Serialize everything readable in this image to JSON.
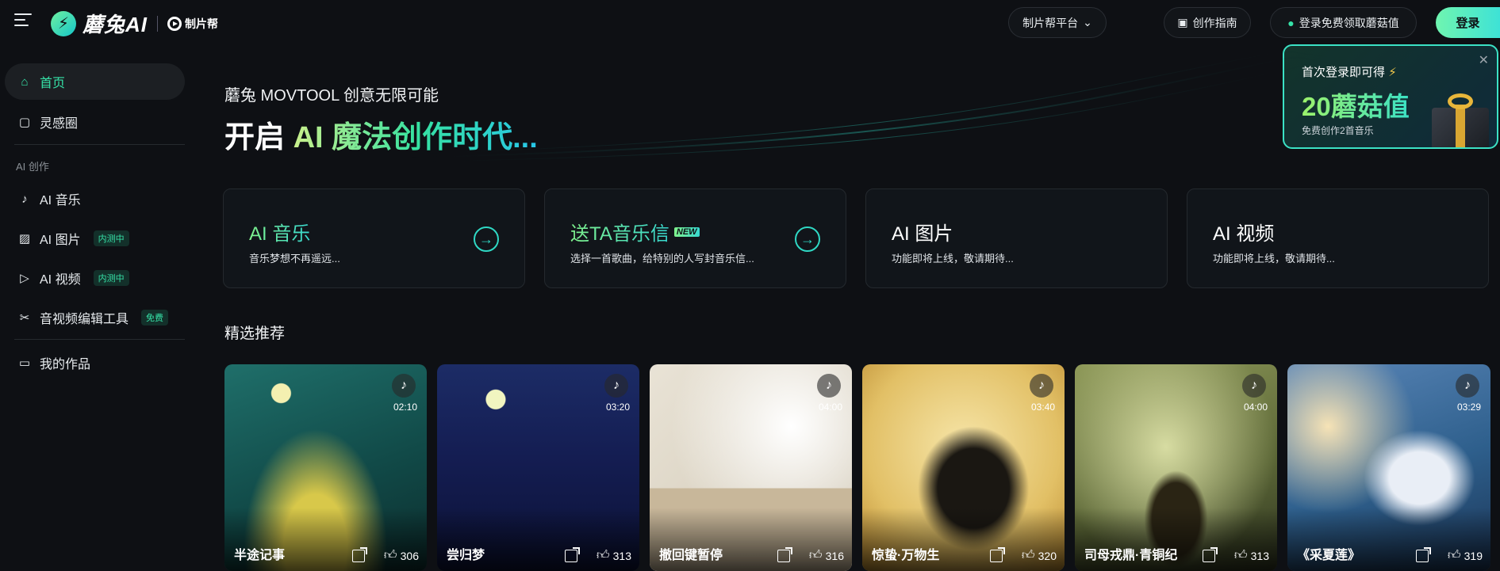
{
  "header": {
    "brand": "蘑兔AI",
    "partner": "制片帮",
    "platform_label": "制片帮平台",
    "guide_label": "创作指南",
    "reward_label": "登录免费领取蘑菇值",
    "login_label": "登录"
  },
  "sidebar": {
    "home": "首页",
    "inspiration": "灵感圈",
    "section_label": "AI 创作",
    "music": "AI 音乐",
    "image": "AI 图片",
    "image_badge": "内测中",
    "video": "AI 视频",
    "video_badge": "内测中",
    "editor": "音视频编辑工具",
    "editor_badge": "免费",
    "works": "我的作品"
  },
  "hero": {
    "subtitle": "蘑兔 MOVTOOL 创意无限可能",
    "title_plain": "开启 ",
    "title_gradient": "AI 魔法创作时代..."
  },
  "promo": {
    "line1": "首次登录即可得",
    "amount": "20蘑菇值",
    "small": "免费创作2首音乐"
  },
  "features": [
    {
      "title": "AI 音乐",
      "desc": "音乐梦想不再遥远...",
      "accent": true,
      "arrow": true
    },
    {
      "title": "送TA音乐信",
      "badge": "NEW",
      "desc": "选择一首歌曲，给特别的人写封音乐信...",
      "accent": true,
      "arrow": true
    },
    {
      "title": "AI 图片",
      "desc": "功能即将上线，敬请期待...",
      "accent": false,
      "arrow": false
    },
    {
      "title": "AI 视频",
      "desc": "功能即将上线，敬请期待...",
      "accent": false,
      "arrow": false
    }
  ],
  "section_title": "精选推荐",
  "tracks": [
    {
      "title": "半途记事",
      "duration": "02:10",
      "likes": "306"
    },
    {
      "title": "尝归梦",
      "duration": "03:20",
      "likes": "313"
    },
    {
      "title": "撤回键暂停",
      "duration": "04:00",
      "likes": "316"
    },
    {
      "title": "惊蛰·万物生",
      "duration": "03:40",
      "likes": "320"
    },
    {
      "title": "司母戎鼎·青铜纪",
      "duration": "04:00",
      "likes": "313"
    },
    {
      "title": "《采夏莲》",
      "duration": "03:29",
      "likes": "319"
    }
  ],
  "icons": {
    "menu": "menu-icon",
    "home": "home-icon",
    "inspiration": "chat-icon",
    "music": "music-icon",
    "image": "image-icon",
    "video": "video-icon",
    "editor": "scissors-icon",
    "works": "folder-icon",
    "arrow": "arrow-right-icon",
    "note": "music-note-icon",
    "share": "share-icon",
    "like": "thumbs-up-icon"
  },
  "colors": {
    "accent": "#36e3a8",
    "background": "#0e1014"
  }
}
